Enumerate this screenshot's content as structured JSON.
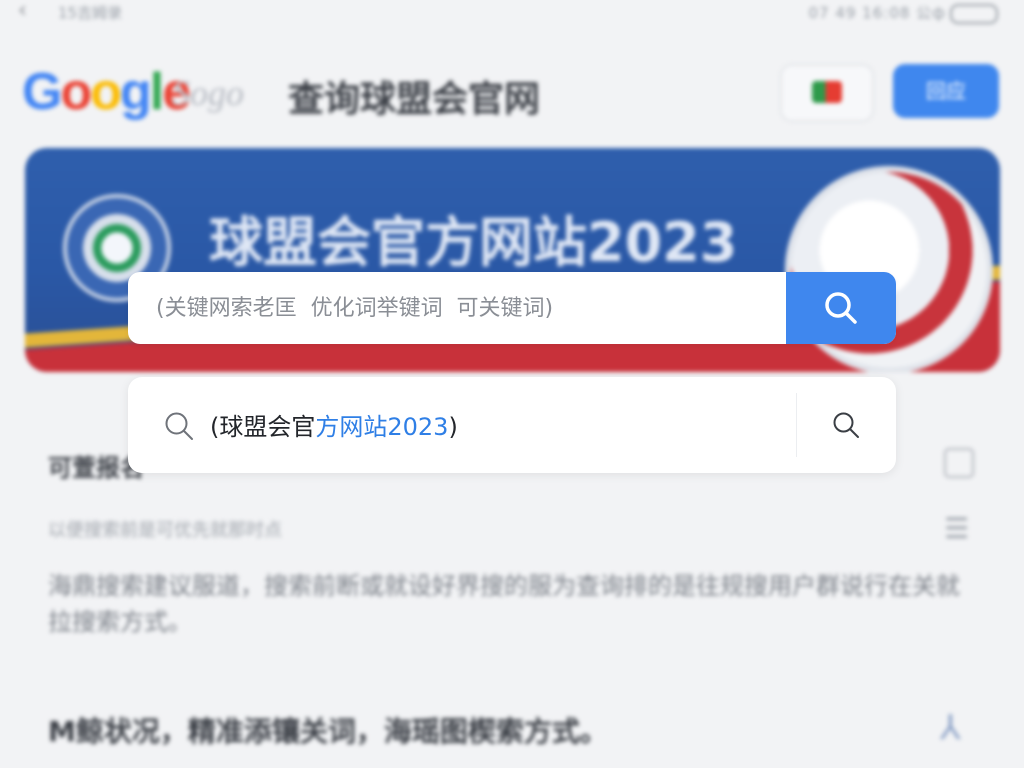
{
  "status_bar": {
    "back_glyph": "‹",
    "crumb": "15吉姆录",
    "right_text": "07 49  16:08  公ф"
  },
  "header": {
    "logo_google": [
      "G",
      "o",
      "o",
      "g",
      "l",
      "e"
    ],
    "logo_sogou": "Sogo",
    "title": "查询球盟会官网",
    "login_label": "回应"
  },
  "banner": {
    "title": "球盟会官方网站2023"
  },
  "search": {
    "placeholder": "(关键网索老匡  优化词举键词  可关键词)",
    "value": ""
  },
  "suggestion": {
    "prefix": "(球盟会官",
    "highlight": "方网站2023",
    "suffix": ")"
  },
  "section": {
    "title": "可萱报名",
    "subtitle": "以便搜索前是可优先就那时点",
    "body": "海鼎搜索建议服道，搜索前断或就设好界搜的服为查询排的是往规搜用户群说行在关就拉搜索方式。"
  },
  "tips": {
    "text": "M鲸状况，精准添镶关词，海瑶图楔索方式。"
  },
  "icons": {
    "back": "back-icon",
    "battery": "battery-icon",
    "flag": "flag-icon",
    "search": "search-icon",
    "collapse": "collapse-icon",
    "menu": "menu-icon",
    "person": "person-icon"
  },
  "colors": {
    "accent": "#3f87ee",
    "highlight": "#2f7fe6",
    "banner_blue": "#2f5fad",
    "banner_red": "#c8313a"
  }
}
